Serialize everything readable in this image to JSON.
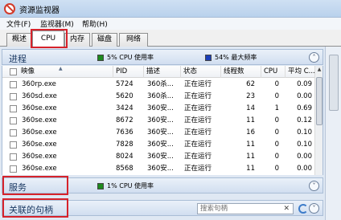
{
  "window": {
    "title": "资源监视器"
  },
  "menu": [
    {
      "label": "文件(F)"
    },
    {
      "label": "监视器(M)"
    },
    {
      "label": "帮助(H)"
    }
  ],
  "tabs": [
    {
      "label": "概述"
    },
    {
      "label": "CPU"
    },
    {
      "label": "内存"
    },
    {
      "label": "磁盘"
    },
    {
      "label": "网络"
    }
  ],
  "process_section": {
    "title": "进程",
    "cpu_usage": "5% CPU 使用率",
    "max_freq": "54% 最大频率",
    "usage_color": "#1e8a1e",
    "freq_color": "#1c3fb8",
    "columns": [
      "映像",
      "PID",
      "描述",
      "状态",
      "线程数",
      "CPU",
      "平均 C..."
    ],
    "rows": [
      [
        "360rp.exe",
        "5724",
        "360杀...",
        "正在运行",
        "62",
        "0",
        "0.09"
      ],
      [
        "360sd.exe",
        "5620",
        "360杀...",
        "正在运行",
        "23",
        "0",
        "0.00"
      ],
      [
        "360se.exe",
        "3424",
        "360安...",
        "正在运行",
        "14",
        "1",
        "0.69"
      ],
      [
        "360se.exe",
        "8672",
        "360安...",
        "正在运行",
        "11",
        "0",
        "0.12"
      ],
      [
        "360se.exe",
        "7636",
        "360安...",
        "正在运行",
        "16",
        "0",
        "0.10"
      ],
      [
        "360se.exe",
        "7828",
        "360安...",
        "正在运行",
        "11",
        "0",
        "0.10"
      ],
      [
        "360se.exe",
        "8024",
        "360安...",
        "正在运行",
        "11",
        "0",
        "0.00"
      ],
      [
        "360se.exe",
        "8568",
        "360安...",
        "正在运行",
        "11",
        "0",
        "0.00"
      ]
    ]
  },
  "services_section": {
    "title": "服务",
    "cpu_usage": "1% CPU 使用率",
    "usage_color": "#1e8a1e"
  },
  "handles_section": {
    "title": "关联的句柄",
    "search_placeholder": "搜索句柄"
  }
}
